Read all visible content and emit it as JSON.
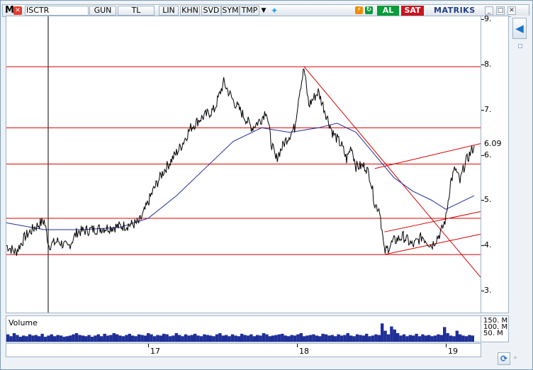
{
  "toolbar": {
    "menu_letter": "M",
    "symbol": "ISCTR",
    "buttons": [
      "GUN",
      "TL",
      "LIN",
      "KHN",
      "SVD",
      "SYM",
      "TMP"
    ],
    "al": "AL",
    "sat": "SAT",
    "brand": "MATRIKS"
  },
  "icons": {
    "close": "close-icon",
    "dropdown": "chevron-down-icon",
    "twitter": "twitter-icon",
    "lightning": "lightning-icon",
    "refresh": "refresh-icon",
    "back": "arrow-left-icon"
  },
  "colors": {
    "price_line": "#000000",
    "moving_average": "#1f2f99",
    "horizontal_lines": "#d40000",
    "trend_lines": "#d40000",
    "volume_bars": "#1f2f99",
    "al": "#0a9b3a",
    "sat": "#c9141c"
  },
  "volume_label": "Volume",
  "chart_data": {
    "type": "line",
    "symbol": "ISCTR",
    "x_ticks": [
      "17",
      "18",
      "19"
    ],
    "y_ticks": [
      "3.",
      "4.",
      "5.",
      "6.",
      "7.",
      "8.",
      "9."
    ],
    "ylim": [
      2.8,
      9.0
    ],
    "last_value_label": "6.09",
    "price_series": [
      [
        0,
        4.0
      ],
      [
        2,
        3.85
      ],
      [
        4,
        4.2
      ],
      [
        6,
        4.4
      ],
      [
        8,
        4.55
      ],
      [
        9,
        4.0
      ],
      [
        11,
        4.1
      ],
      [
        13,
        3.95
      ],
      [
        15,
        4.3
      ],
      [
        18,
        4.35
      ],
      [
        22,
        4.4
      ],
      [
        26,
        4.45
      ],
      [
        28,
        4.5
      ],
      [
        29,
        4.7
      ],
      [
        31,
        5.2
      ],
      [
        33,
        5.6
      ],
      [
        35,
        5.9
      ],
      [
        37,
        6.2
      ],
      [
        39,
        6.6
      ],
      [
        41,
        6.8
      ],
      [
        44,
        7.0
      ],
      [
        46,
        7.6
      ],
      [
        48,
        7.2
      ],
      [
        50,
        6.9
      ],
      [
        52,
        6.6
      ],
      [
        54,
        6.8
      ],
      [
        55,
        7.0
      ],
      [
        56,
        6.3
      ],
      [
        57,
        5.9
      ],
      [
        59,
        6.3
      ],
      [
        61,
        6.6
      ],
      [
        62,
        7.4
      ],
      [
        63,
        7.9
      ],
      [
        64,
        7.1
      ],
      [
        66,
        7.4
      ],
      [
        68,
        6.8
      ],
      [
        69,
        6.5
      ],
      [
        71,
        6.2
      ],
      [
        72,
        5.9
      ],
      [
        73,
        6.2
      ],
      [
        74,
        5.75
      ],
      [
        76,
        5.75
      ],
      [
        77,
        5.5
      ],
      [
        78,
        4.9
      ],
      [
        79,
        4.8
      ],
      [
        80,
        3.85
      ],
      [
        82,
        4.1
      ],
      [
        84,
        4.2
      ],
      [
        86,
        4.0
      ],
      [
        88,
        4.2
      ],
      [
        90,
        4.0
      ],
      [
        92,
        4.3
      ],
      [
        93,
        4.6
      ],
      [
        94,
        5.4
      ],
      [
        95,
        5.7
      ],
      [
        96,
        5.4
      ],
      [
        97,
        5.8
      ],
      [
        98,
        6.0
      ],
      [
        99,
        6.2
      ]
    ],
    "moving_average": [
      [
        0,
        4.5
      ],
      [
        8,
        4.35
      ],
      [
        16,
        4.35
      ],
      [
        24,
        4.4
      ],
      [
        30,
        4.6
      ],
      [
        36,
        5.1
      ],
      [
        42,
        5.7
      ],
      [
        48,
        6.3
      ],
      [
        54,
        6.6
      ],
      [
        60,
        6.5
      ],
      [
        66,
        6.6
      ],
      [
        70,
        6.7
      ],
      [
        74,
        6.5
      ],
      [
        78,
        6.0
      ],
      [
        82,
        5.5
      ],
      [
        86,
        5.2
      ],
      [
        90,
        5.0
      ],
      [
        93,
        4.8
      ],
      [
        96,
        4.95
      ],
      [
        99,
        5.1
      ]
    ],
    "horizontal_levels": [
      3.8,
      4.6,
      5.8,
      6.6,
      7.95
    ],
    "volume_axis": [
      "150. M",
      "100. M",
      "50. M"
    ],
    "volume_series": [
      12,
      9,
      14,
      11,
      8,
      10,
      9,
      12,
      10,
      11,
      9,
      13,
      8,
      10,
      12,
      9,
      11,
      10,
      8,
      9,
      10,
      12,
      14,
      11,
      10,
      9,
      11,
      8,
      10,
      12,
      9,
      13,
      10,
      11,
      14,
      12,
      10,
      9,
      11,
      13,
      10,
      9,
      12,
      11,
      10,
      14,
      12,
      9,
      11,
      10,
      13,
      12,
      9,
      10,
      14,
      11,
      9,
      12,
      10,
      11,
      13,
      10,
      9,
      12,
      11,
      10,
      9,
      12,
      14,
      10,
      11,
      9,
      12,
      10,
      9,
      13,
      11,
      10,
      12,
      9,
      11,
      10,
      14,
      12,
      9,
      10,
      11,
      12,
      13,
      10,
      9,
      11,
      10,
      12,
      14,
      9,
      10,
      11,
      12,
      10,
      9,
      13,
      12,
      10,
      11,
      9,
      12,
      10,
      11,
      14,
      10,
      9,
      12,
      11,
      10,
      13,
      9,
      10,
      12,
      11,
      30,
      18,
      12,
      25,
      20,
      14,
      10,
      12,
      9,
      11,
      10,
      13,
      9,
      12,
      10,
      11,
      9,
      10,
      12,
      11,
      24,
      14,
      10,
      9,
      18,
      12,
      10,
      9,
      11,
      10
    ]
  }
}
